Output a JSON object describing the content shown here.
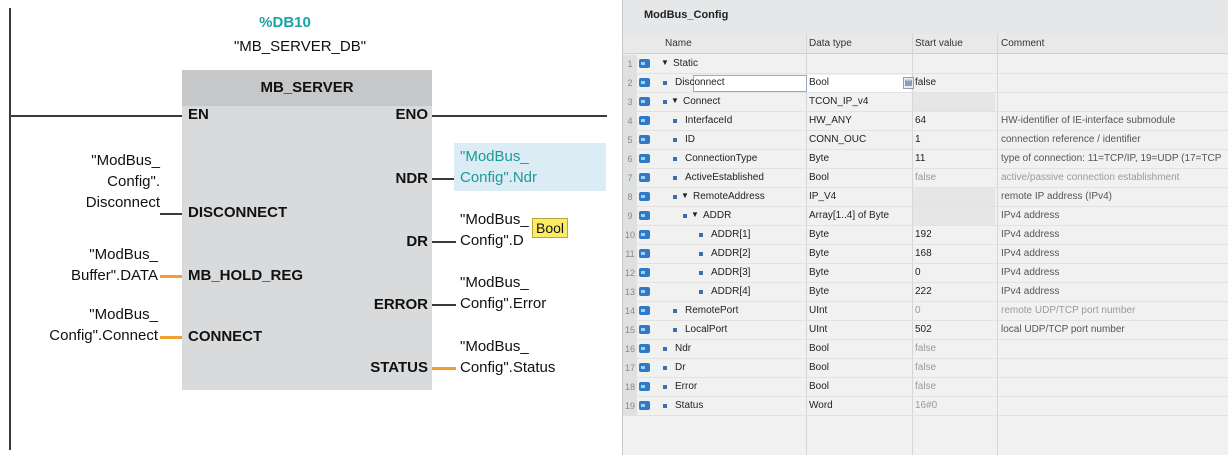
{
  "lad": {
    "db_number": "%DB10",
    "db_name": "\"MB_SERVER_DB\"",
    "block_title": "MB_SERVER",
    "pins_left": {
      "en": "EN",
      "disconnect": "DISCONNECT",
      "mb_hold_reg": "MB_HOLD_REG",
      "connect": "CONNECT"
    },
    "pins_right": {
      "eno": "ENO",
      "ndr": "NDR",
      "dr": "DR",
      "error": "ERROR",
      "status": "STATUS"
    },
    "operands_left": {
      "disconnect": [
        "\"ModBus_",
        "Config\".",
        "Disconnect"
      ],
      "mb_hold_reg": [
        "\"ModBus_",
        "Buffer\".DATA"
      ],
      "connect": [
        "\"ModBus_",
        "Config\".Connect"
      ]
    },
    "operands_right": {
      "ndr": [
        "\"ModBus_",
        "Config\".Ndr"
      ],
      "dr": [
        "\"ModBus_",
        "Config\".D"
      ],
      "error": [
        "\"ModBus_",
        "Config\".Error"
      ],
      "status": [
        "\"ModBus_",
        "Config\".Status"
      ]
    },
    "tooltip": "Bool"
  },
  "db": {
    "title": "ModBus_Config",
    "headers": {
      "name": "Name",
      "data_type": "Data type",
      "start_value": "Start value",
      "comment": "Comment"
    },
    "rows": [
      {
        "n": "1",
        "name": "Static",
        "type": "",
        "start": "",
        "comment": "",
        "level": 0,
        "expand": true,
        "dot": false,
        "light": false
      },
      {
        "n": "2",
        "name": "Disconnect",
        "type": "Bool",
        "start": "false",
        "comment": "",
        "level": 1,
        "expand": false,
        "dot": true,
        "light": false,
        "editing": true
      },
      {
        "n": "3",
        "name": "Connect",
        "type": "TCON_IP_v4",
        "start": "",
        "comment": "",
        "level": 1,
        "expand": true,
        "dot": true,
        "light": false
      },
      {
        "n": "4",
        "name": "InterfaceId",
        "type": "HW_ANY",
        "start": "64",
        "comment": "HW-identifier of IE-interface submodule",
        "level": 2,
        "expand": false,
        "dot": true,
        "light": false
      },
      {
        "n": "5",
        "name": "ID",
        "type": "CONN_OUC",
        "start": "1",
        "comment": "connection reference / identifier",
        "level": 2,
        "expand": false,
        "dot": true,
        "light": false
      },
      {
        "n": "6",
        "name": "ConnectionType",
        "type": "Byte",
        "start": "11",
        "comment": "type of connection: 11=TCP/IP, 19=UDP (17=TCP",
        "level": 2,
        "expand": false,
        "dot": true,
        "light": false
      },
      {
        "n": "7",
        "name": "ActiveEstablished",
        "type": "Bool",
        "start": "false",
        "comment": "active/passive connection establishment",
        "level": 2,
        "expand": false,
        "dot": true,
        "light": true
      },
      {
        "n": "8",
        "name": "RemoteAddress",
        "type": "IP_V4",
        "start": "",
        "comment": "remote IP address (IPv4)",
        "level": 2,
        "expand": true,
        "dot": true,
        "light": false
      },
      {
        "n": "9",
        "name": "ADDR",
        "type": "Array[1..4] of Byte",
        "start": "",
        "comment": "IPv4 address",
        "level": 3,
        "expand": true,
        "dot": true,
        "light": false
      },
      {
        "n": "10",
        "name": "ADDR[1]",
        "type": "Byte",
        "start": "192",
        "comment": "IPv4 address",
        "level": 4,
        "expand": false,
        "dot": true,
        "light": false
      },
      {
        "n": "11",
        "name": "ADDR[2]",
        "type": "Byte",
        "start": "168",
        "comment": "IPv4 address",
        "level": 4,
        "expand": false,
        "dot": true,
        "light": false
      },
      {
        "n": "12",
        "name": "ADDR[3]",
        "type": "Byte",
        "start": "0",
        "comment": "IPv4 address",
        "level": 4,
        "expand": false,
        "dot": true,
        "light": false
      },
      {
        "n": "13",
        "name": "ADDR[4]",
        "type": "Byte",
        "start": "222",
        "comment": "IPv4 address",
        "level": 4,
        "expand": false,
        "dot": true,
        "light": false
      },
      {
        "n": "14",
        "name": "RemotePort",
        "type": "UInt",
        "start": "0",
        "comment": "remote UDP/TCP port number",
        "level": 2,
        "expand": false,
        "dot": true,
        "light": true
      },
      {
        "n": "15",
        "name": "LocalPort",
        "type": "UInt",
        "start": "502",
        "comment": "local UDP/TCP port number",
        "level": 2,
        "expand": false,
        "dot": true,
        "light": false
      },
      {
        "n": "16",
        "name": "Ndr",
        "type": "Bool",
        "start": "false",
        "comment": "",
        "level": 1,
        "expand": false,
        "dot": true,
        "light": true
      },
      {
        "n": "17",
        "name": "Dr",
        "type": "Bool",
        "start": "false",
        "comment": "",
        "level": 1,
        "expand": false,
        "dot": true,
        "light": true
      },
      {
        "n": "18",
        "name": "Error",
        "type": "Bool",
        "start": "false",
        "comment": "",
        "level": 1,
        "expand": false,
        "dot": true,
        "light": true
      },
      {
        "n": "19",
        "name": "Status",
        "type": "Word",
        "start": "16#0",
        "comment": "",
        "level": 1,
        "expand": false,
        "dot": true,
        "light": true
      }
    ]
  },
  "colors": {
    "accent": "#1aa3a3",
    "wire_orange": "#f0a030",
    "tooltip": "#fcec63",
    "db_icon": "#2e7bc4"
  }
}
